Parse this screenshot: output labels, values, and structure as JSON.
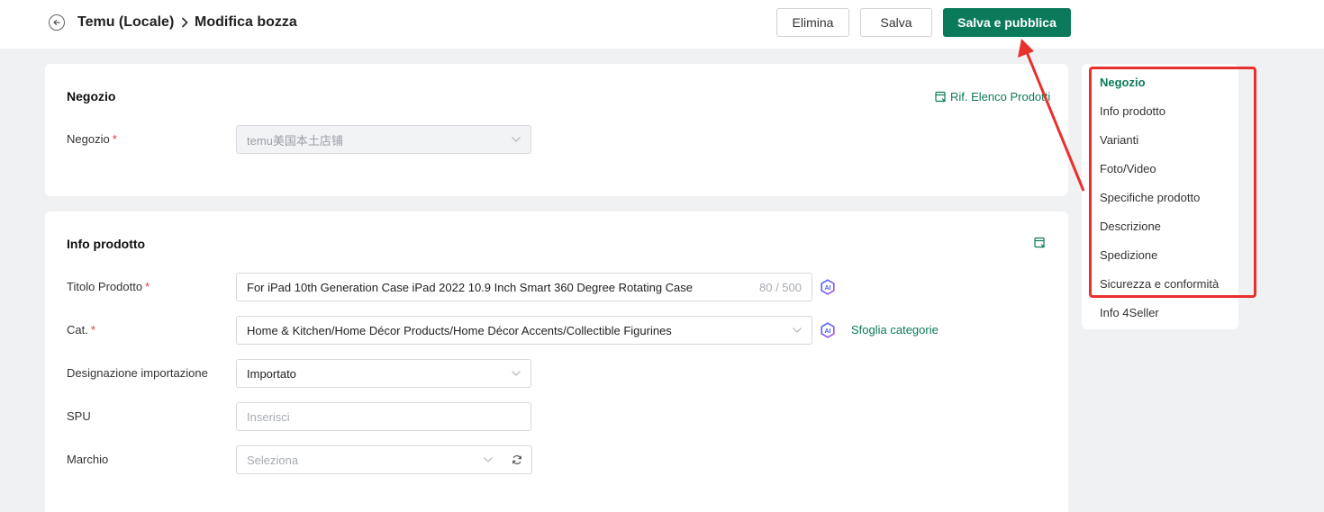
{
  "header": {
    "breadcrumb_root": "Temu (Locale)",
    "breadcrumb_current": "Modifica bozza",
    "delete_label": "Elimina",
    "save_label": "Salva",
    "save_publish_label": "Salva e pubblica"
  },
  "store_section": {
    "title": "Negozio",
    "ref_link": "Rif. Elenco Prodotti",
    "store_label": "Negozio",
    "required_mark": "*",
    "store_value": "temu美国本土店铺"
  },
  "info_section": {
    "title": "Info prodotto",
    "product_title_label": "Titolo Prodotto",
    "product_title_value": "For iPad 10th Generation Case iPad 2022 10.9 Inch Smart 360 Degree Rotating Case",
    "product_title_counter": "80 / 500",
    "category_label": "Cat.",
    "category_value": "Home & Kitchen/Home Décor Products/Home Décor Accents/Collectible Figurines",
    "browse_categories": "Sfoglia categorie",
    "import_label": "Designazione importazione",
    "import_value": "Importato",
    "spu_label": "SPU",
    "spu_placeholder": "Inserisci",
    "brand_label": "Marchio",
    "brand_placeholder": "Seleziona",
    "ai_badge": "AI"
  },
  "side_nav": {
    "items": [
      {
        "label": "Negozio",
        "active": true
      },
      {
        "label": "Info prodotto",
        "active": false
      },
      {
        "label": "Varianti",
        "active": false
      },
      {
        "label": "Foto/Video",
        "active": false
      },
      {
        "label": "Specifiche prodotto",
        "active": false
      },
      {
        "label": "Descrizione",
        "active": false
      },
      {
        "label": "Spedizione",
        "active": false
      },
      {
        "label": "Sicurezza e conformità",
        "active": false
      },
      {
        "label": "Info 4Seller",
        "active": false
      }
    ]
  },
  "colors": {
    "primary": "#0b7a5b",
    "required": "#e0393e",
    "annotation": "#e8302c"
  },
  "icons": [
    "back-arrow-icon",
    "chevron-right-icon",
    "chevron-down-icon",
    "link-icon",
    "ai-icon",
    "refresh-icon"
  ]
}
